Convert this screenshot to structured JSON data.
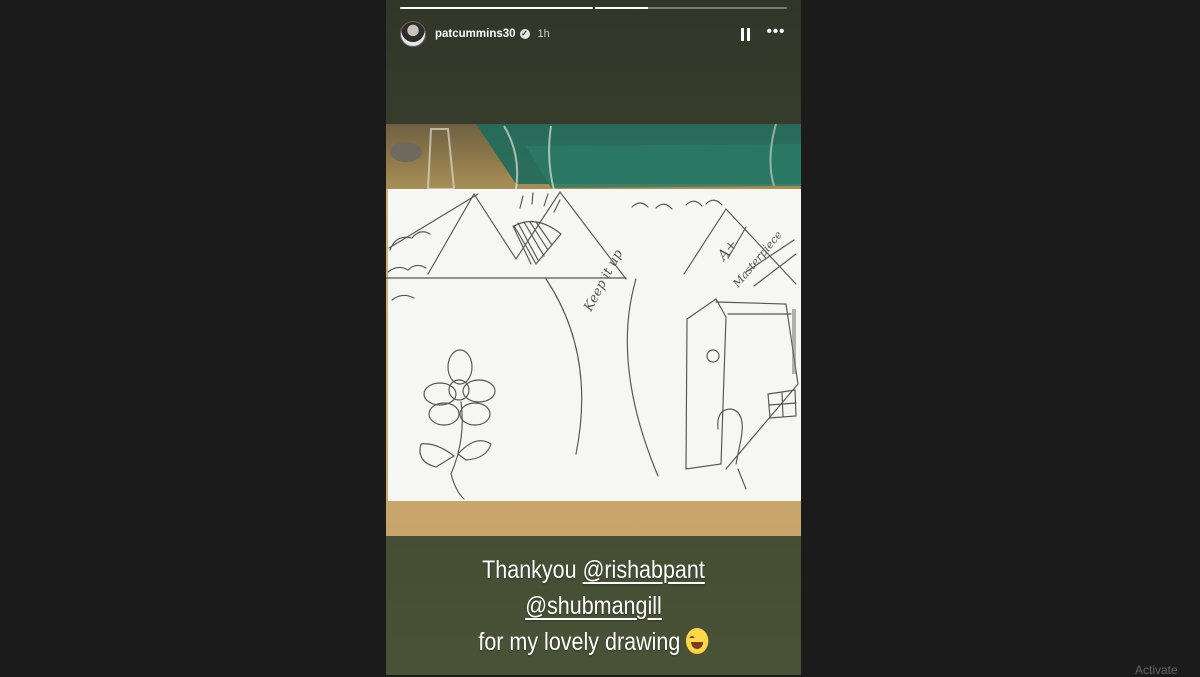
{
  "story": {
    "progress": [
      1.0,
      0.28
    ],
    "user": {
      "username": "patcummins30",
      "time": "1h",
      "verified": true
    },
    "controls": {
      "pause_icon": "pause-icon",
      "more_icon": "more-icon"
    },
    "drawing": {
      "center_text": "Keep it up",
      "grade_text": "A+",
      "note_text": "Masterpiece"
    },
    "caption": {
      "prefix": "Thankyou",
      "mention_1": "@rishabpant",
      "mention_2": "@shubmangill",
      "line_2": "for my lovely drawing",
      "emoji": "laughing-emoji"
    }
  },
  "system": {
    "watermark": "Activate"
  }
}
